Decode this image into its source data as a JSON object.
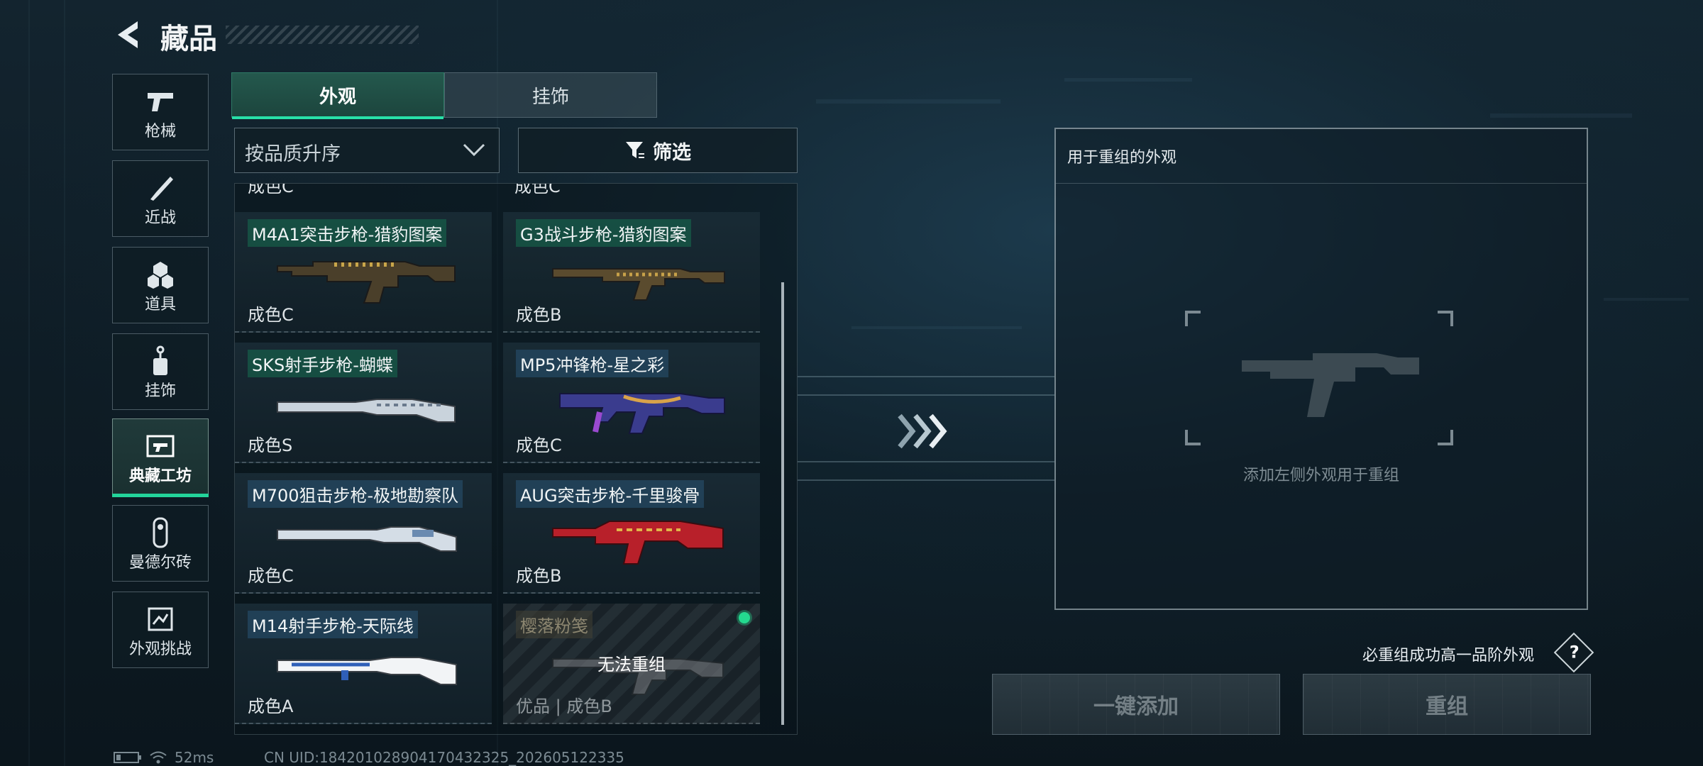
{
  "header": {
    "title": "藏品"
  },
  "nav": [
    {
      "label": "枪械",
      "icon": "pistol-icon"
    },
    {
      "label": "近战",
      "icon": "knife-icon"
    },
    {
      "label": "道具",
      "icon": "grenade-icon"
    },
    {
      "label": "挂饰",
      "icon": "charm-icon"
    },
    {
      "label": "典藏工坊",
      "icon": "workshop-icon",
      "active": true
    },
    {
      "label": "曼德尔砖",
      "icon": "brick-icon"
    },
    {
      "label": "外观挑战",
      "icon": "challenge-icon"
    }
  ],
  "tabs": {
    "appearance": "外观",
    "pendant": "挂饰"
  },
  "sort": {
    "label": "按品质升序"
  },
  "filter": {
    "label": "筛选"
  },
  "partial_row": {
    "left": "成色C",
    "right": "成色C"
  },
  "items": [
    {
      "name": "M4A1突击步枪-猎豹图案",
      "condition": "成色C",
      "tag": "green"
    },
    {
      "name": "G3战斗步枪-猎豹图案",
      "condition": "成色B",
      "tag": "green"
    },
    {
      "name": "SKS射手步枪-蝴蝶",
      "condition": "成色S",
      "tag": "green"
    },
    {
      "name": "MP5冲锋枪-星之彩",
      "condition": "成色C",
      "tag": "blue"
    },
    {
      "name": "M700狙击步枪-极地勘察队",
      "condition": "成色C",
      "tag": "blue"
    },
    {
      "name": "AUG突击步枪-千里骏骨",
      "condition": "成色B",
      "tag": "blue"
    },
    {
      "name": "M14射手步枪-天际线",
      "condition": "成色A",
      "tag": "blue"
    },
    {
      "name": "樱落粉笺",
      "condition": "优品 | 成色B",
      "locked_text": "无法重组",
      "locked": true
    }
  ],
  "recompose": {
    "title": "用于重组的外观",
    "hint": "添加左侧外观用于重组",
    "guarantee": "必重组成功高一品阶外观",
    "help": "?",
    "onekey_label": "一键添加",
    "recompose_label": "重组"
  },
  "status": {
    "ping": "52ms",
    "uid": "CN UID:18420102890417043232​5_202605122335"
  },
  "colors": {
    "accent": "#23d49a",
    "tab_active": "#24584d"
  }
}
